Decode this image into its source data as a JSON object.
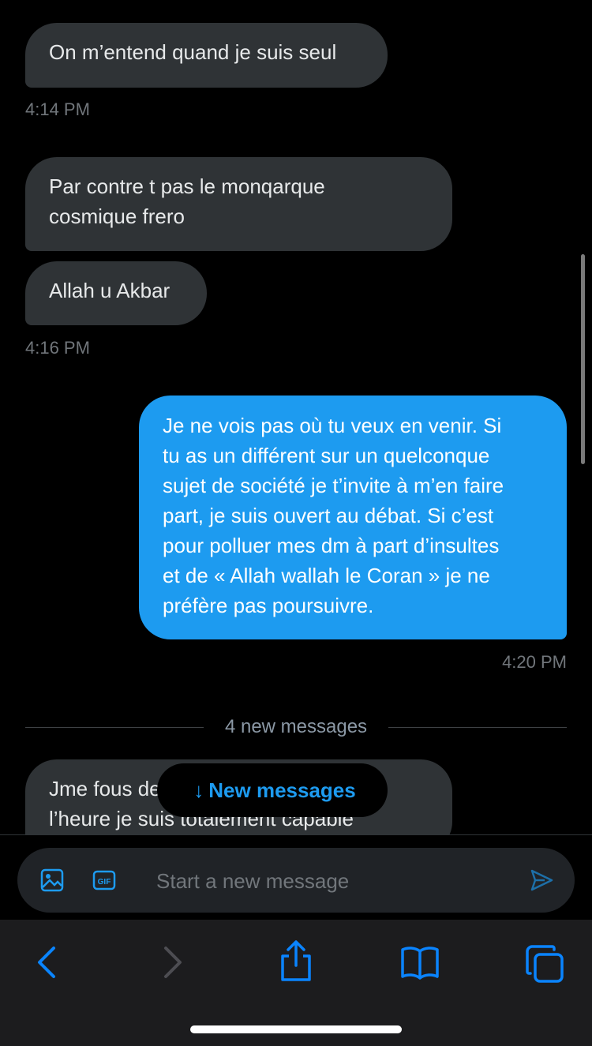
{
  "messages": [
    {
      "dir": "in",
      "text": "On m’entend quand je suis seul"
    },
    {
      "dir": "in",
      "text": "Par contre t pas le monqarque\ncosmique  frero"
    },
    {
      "dir": "in",
      "text": "Allah u Akbar"
    },
    {
      "dir": "out",
      "text": "Je ne vois pas où tu veux en venir. Si\ntu as un différent sur un quelconque\nsujet de société je t’invite à m’en faire\npart, je suis ouvert au débat. Si c’est\npour polluer mes dm à part d’insultes\net de « Allah wallah le Coran » je ne\npréfère pas poursuivre."
    },
    {
      "dir": "in",
      "text": "Jme fous de ta gueule depuis tout à\nl’heure je suis totalement capable"
    }
  ],
  "timestamps": [
    "4:14 PM",
    "4:16 PM",
    "4:20 PM"
  ],
  "divider_label": "4 new messages",
  "new_messages_pill": {
    "arrow": "↓",
    "label": "New messages"
  },
  "composer": {
    "placeholder": "Start a new message"
  },
  "icons": {
    "media": "image-icon",
    "gif": "gif-icon",
    "send": "send-icon",
    "back": "back-chevron-icon",
    "forward": "forward-chevron-icon",
    "share": "share-icon",
    "bookmarks": "book-icon",
    "tabs": "tabs-icon"
  },
  "colors": {
    "accent": "#1d9bf0",
    "incoming_bubble": "#2f3336",
    "background": "#000000",
    "toolbar": "#1c1c1e",
    "safari_blue": "#0a84ff"
  }
}
